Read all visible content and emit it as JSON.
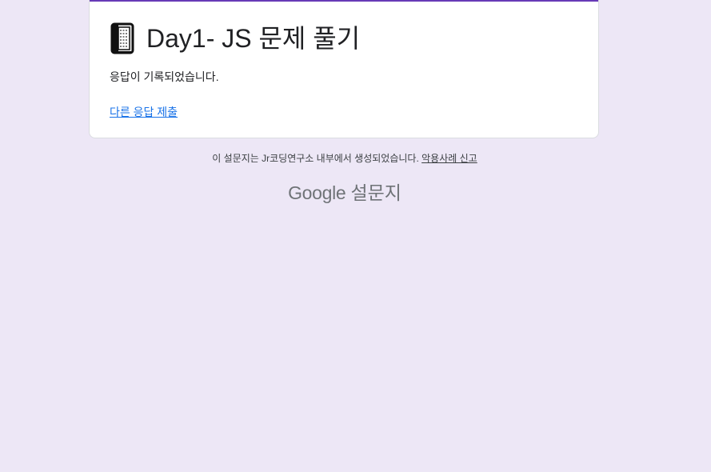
{
  "form": {
    "title": "Day1- JS 문제 풀기",
    "confirmation_message": "응답이 기록되었습니다.",
    "resubmit_link": "다른 응답 제출",
    "accent_color": "#673ab7",
    "background_color": "#ede7f6"
  },
  "footer": {
    "note": "이 설문지는 Jr코딩연구소 내부에서 생성되었습니다.",
    "abuse_link": "악용사례 신고",
    "brand_google": "Google",
    "brand_product": "설문지"
  },
  "icons": {
    "title_icon": "notebook-icon"
  }
}
